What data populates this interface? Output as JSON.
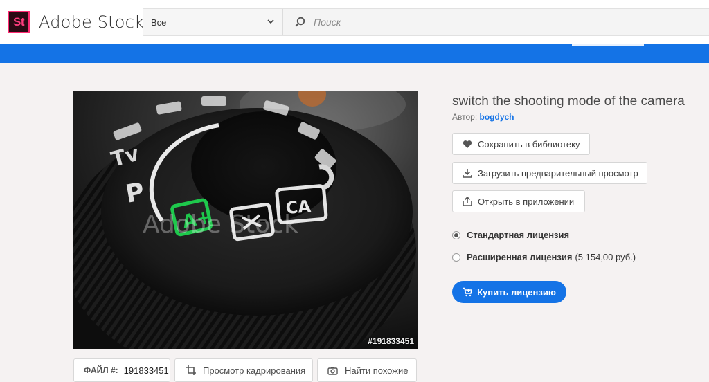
{
  "header": {
    "logo_text": "St",
    "brand": "Adobe Stock",
    "category_selected": "Все",
    "search_placeholder": "Поиск"
  },
  "asset": {
    "title": "switch the shooting mode of the camera",
    "author_label": "Автор:",
    "author_name": "bogdych",
    "watermark": "Adobe Stock",
    "file_id_overlay": "#191833451"
  },
  "actions": {
    "save": "Сохранить в библиотеку",
    "download": "Загрузить предварительный просмотр",
    "open": "Открыть в приложении"
  },
  "licenses": {
    "standard": "Стандартная лицензия",
    "extended": "Расширенная лицензия",
    "extended_price": "(5 154,00 руб.)",
    "selected": "standard"
  },
  "buy_label": "Купить лицензию",
  "bottom": {
    "file_label": "ФАЙЛ #:",
    "file_number": "191833451",
    "crop_label": "Просмотр кадрирования",
    "similar_label": "Найти похожие"
  },
  "dial_labels": {
    "tv": "Tv",
    "p": "P",
    "auto": "A+",
    "scn": "CA"
  },
  "colors": {
    "accent_blue": "#1473e6",
    "logo_pink": "#ff2b73",
    "auto_green": "#1ec84c"
  }
}
